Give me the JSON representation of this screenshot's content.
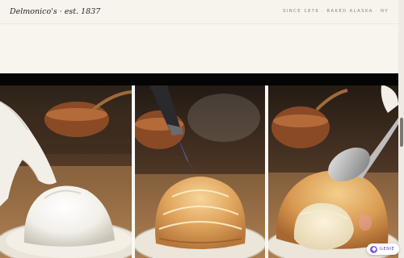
{
  "header": {
    "brand": "Delmonico's · est. 1837",
    "tagline": "SINCE 1876 · BAKED ALASKA · NY"
  },
  "gallery": {
    "panels": [
      {
        "name": "gloved hand shaping meringue dome"
      },
      {
        "name": "torching the meringue"
      },
      {
        "name": "spoon cutting into baked alaska"
      }
    ]
  },
  "badge": {
    "label": "GENIE",
    "icon": "sparkle-icon",
    "color": "#7b5cd6"
  }
}
